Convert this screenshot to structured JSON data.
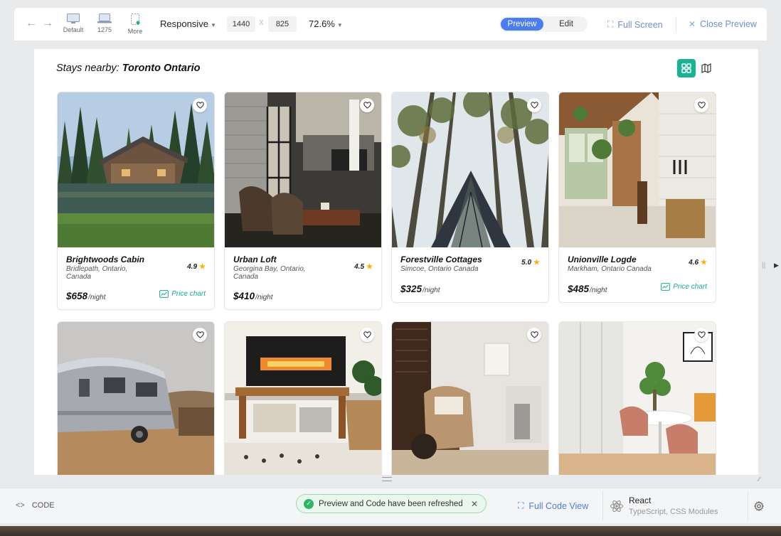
{
  "toolbar": {
    "back_icon": "arrow-left-icon",
    "forward_icon": "arrow-right-icon",
    "devices": [
      {
        "label": "Default",
        "icon": "monitor-icon"
      },
      {
        "label": "1275",
        "icon": "laptop-icon"
      },
      {
        "label": "More",
        "icon": "more-devices-icon"
      }
    ],
    "responsive_label": "Responsive",
    "width_value": "1440",
    "dim_separator": "X",
    "height_value": "825",
    "zoom_label": "72.6%",
    "mode_preview": "Preview",
    "mode_edit": "Edit",
    "full_screen_label": "Full Screen",
    "close_preview_label": "Close Preview"
  },
  "preview": {
    "title_prefix": "Stays nearby:",
    "title_location": "Toronto Ontario",
    "accent_color": "#19b394",
    "listings": [
      {
        "name": "Brightwoods Cabin",
        "location": "Bridlepath, Ontario, Canada",
        "rating": "4.9",
        "price": "$658",
        "unit": "/night",
        "price_chart": "Price chart"
      },
      {
        "name": "Urban Loft",
        "location": "Georgina Bay, Ontario, Canada",
        "rating": "4.5",
        "price": "$410",
        "unit": "/night",
        "price_chart": ""
      },
      {
        "name": "Forestville Cottages",
        "location": "Simcoe, Ontario Canada",
        "rating": "5.0",
        "price": "$325",
        "unit": "/night",
        "price_chart": ""
      },
      {
        "name": "Unionville Logde",
        "location": "Markham, Ontario Canada",
        "rating": "4.6",
        "price": "$485",
        "unit": "/night",
        "price_chart": "Price chart"
      },
      {
        "name": "",
        "location": "",
        "rating": "",
        "price": "",
        "unit": "",
        "price_chart": ""
      },
      {
        "name": "",
        "location": "",
        "rating": "",
        "price": "",
        "unit": "",
        "price_chart": ""
      },
      {
        "name": "",
        "location": "",
        "rating": "",
        "price": "",
        "unit": "",
        "price_chart": ""
      },
      {
        "name": "",
        "location": "",
        "rating": "",
        "price": "",
        "unit": "",
        "price_chart": ""
      }
    ]
  },
  "bottombar": {
    "code_label": "CODE",
    "toast_message": "Preview and Code have been refreshed",
    "full_code_label": "Full Code View",
    "framework_name": "React",
    "framework_sub": "TypeScript, CSS Modules"
  }
}
